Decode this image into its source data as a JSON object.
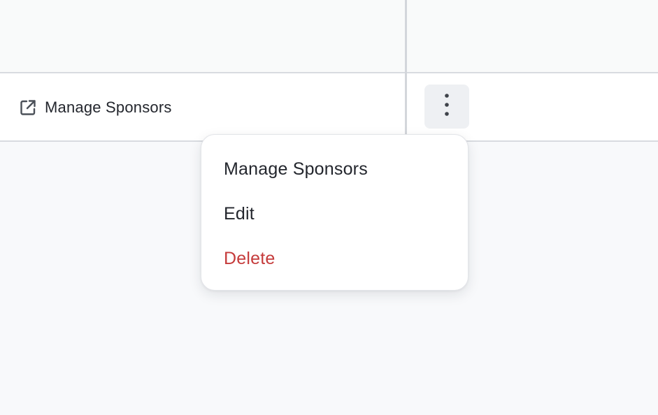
{
  "table": {
    "row": {
      "link_label": "Manage Sponsors",
      "link_icon": "external-link-icon",
      "actions_icon": "kebab-vertical-icon"
    }
  },
  "dropdown": {
    "items": [
      {
        "label": "Manage Sponsors",
        "color": "#23262d"
      },
      {
        "label": "Edit",
        "color": "#23262d"
      },
      {
        "label": "Delete",
        "color": "#c53b3b"
      }
    ]
  },
  "colors": {
    "background": "#f8f9fb",
    "row_background": "#ffffff",
    "border": "#d8dbe0",
    "danger": "#c53b3b",
    "text": "#23262d"
  }
}
